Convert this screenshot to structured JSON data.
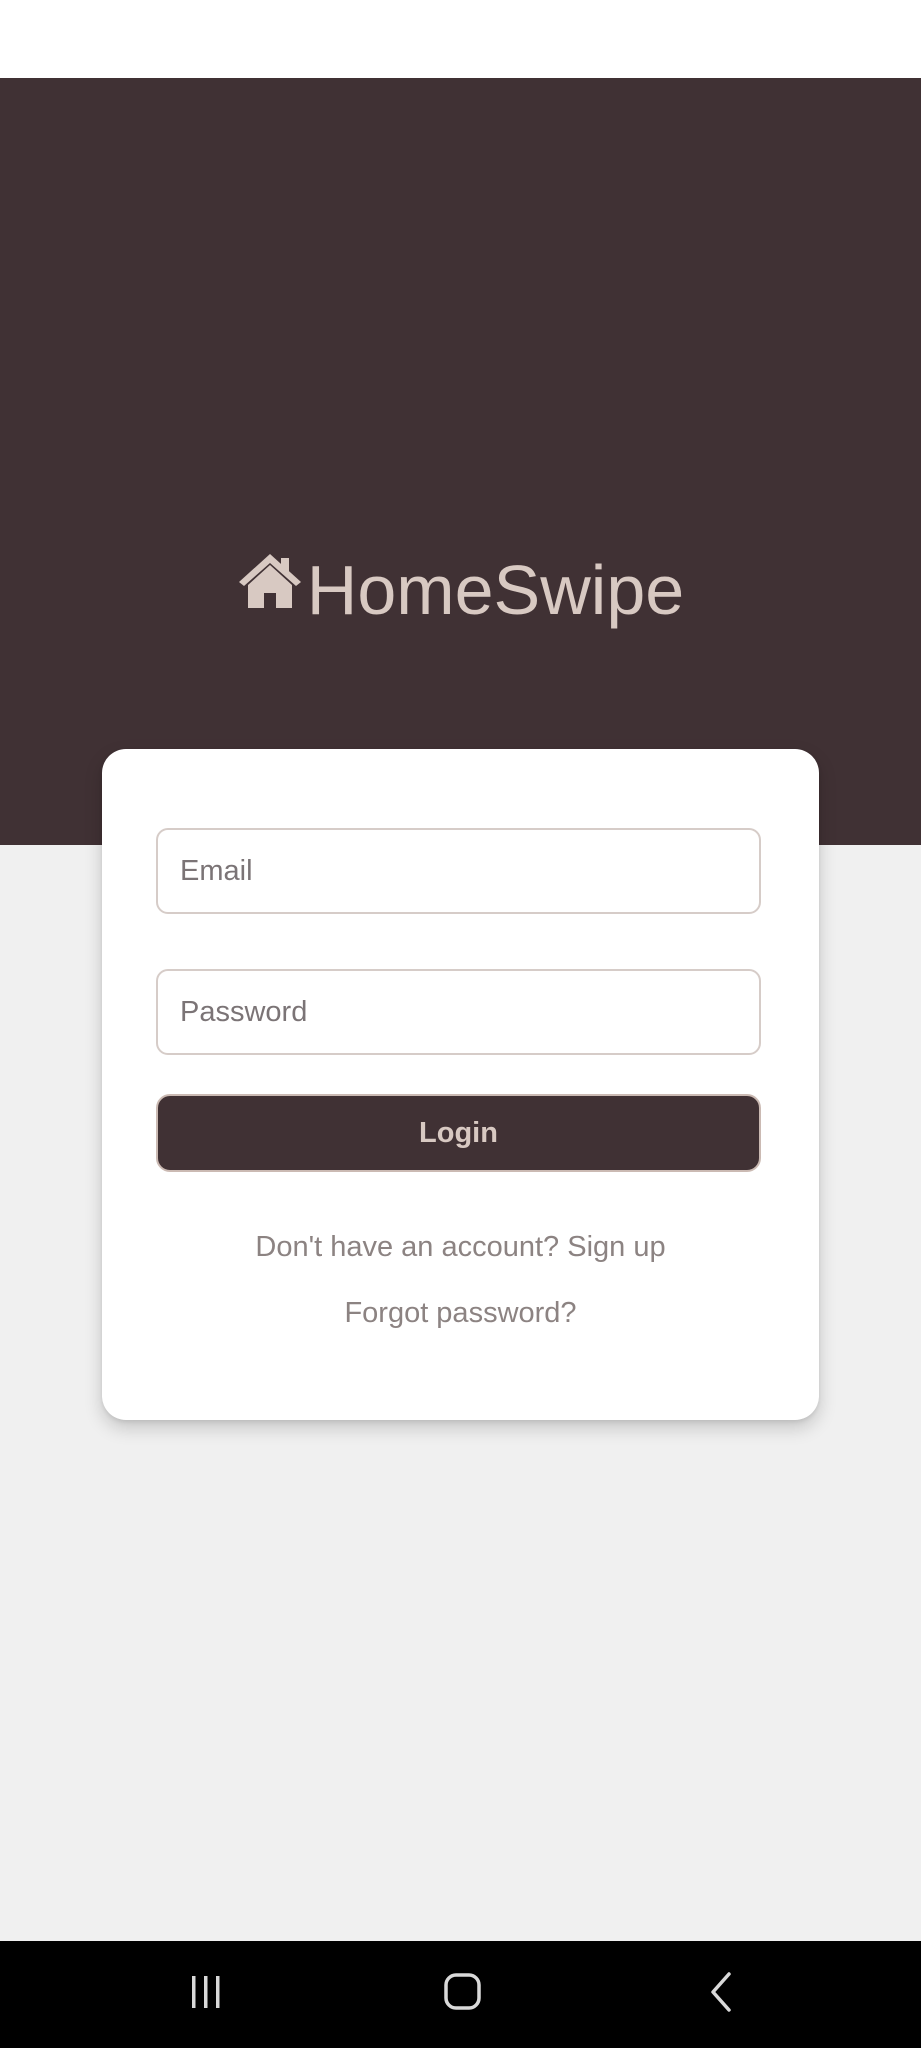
{
  "app": {
    "name": "HomeSwipe",
    "logo_icon": "house-icon"
  },
  "colors": {
    "brand": "#403134",
    "accent_text": "#d8c9c2",
    "background": "#f0f0f0",
    "card": "#ffffff"
  },
  "login_form": {
    "email_placeholder": "Email",
    "email_value": "",
    "password_placeholder": "Password",
    "password_value": "",
    "login_label": "Login",
    "signup_link": "Don't have an account? Sign up",
    "forgot_link": "Forgot password?"
  },
  "system_nav": {
    "recents_icon": "recents-icon",
    "home_icon": "home-icon",
    "back_icon": "back-icon"
  }
}
